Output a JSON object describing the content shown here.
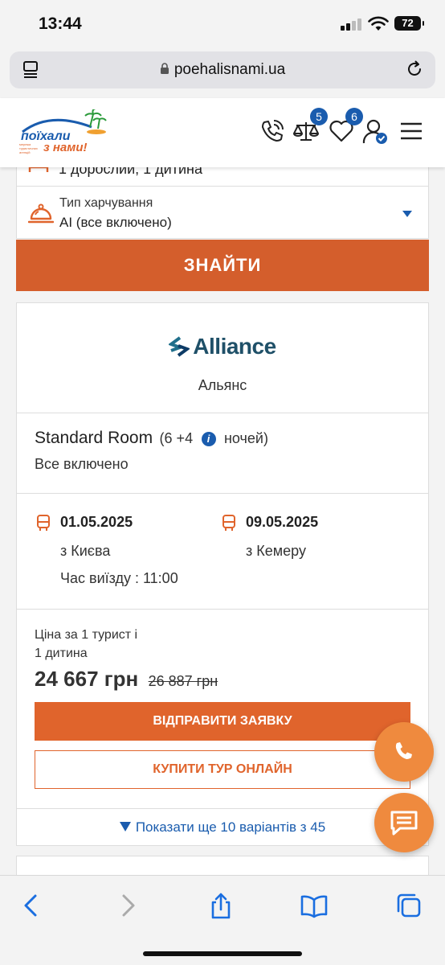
{
  "status_bar": {
    "time": "13:44",
    "battery": "72"
  },
  "browser": {
    "url": "poehalisnami.ua"
  },
  "header": {
    "logo_line1": "поїхали",
    "logo_line2": "з нами!",
    "logo_sub": "мережа туристичних агенцій",
    "compare_count": "5",
    "favorites_count": "6"
  },
  "search_form": {
    "tourists_value": "1 дорослий, 1 дитина",
    "meal_label": "Тип харчування",
    "meal_value": "AI (все включено)",
    "search_button": "ЗНАЙТИ"
  },
  "tour_card": {
    "operator_logo": "Alliance",
    "operator_name": "Альянс",
    "room_type": "Standard Room",
    "nights_prefix": "(6 +4",
    "nights_suffix": "ночей)",
    "meal_plan": "Все включено",
    "depart_date": "01.05.2025",
    "depart_from": "з Києва",
    "depart_time": "Час виїзду : 11:00",
    "return_date": "09.05.2025",
    "return_from": "з Кемеру",
    "price_label_line1": "Ціна за 1 турист і",
    "price_label_line2": "1 дитина",
    "price": "24 667 грн",
    "old_price": "26 887 грн",
    "request_button": "ВІДПРАВИТИ ЗАЯВКУ",
    "buy_button": "КУПИТИ ТУР ОНЛАЙН",
    "more_variants": "Показати ще 10 варіантів з 45"
  },
  "colors": {
    "accent": "#e0642c",
    "brand_blue": "#1a5cae"
  }
}
